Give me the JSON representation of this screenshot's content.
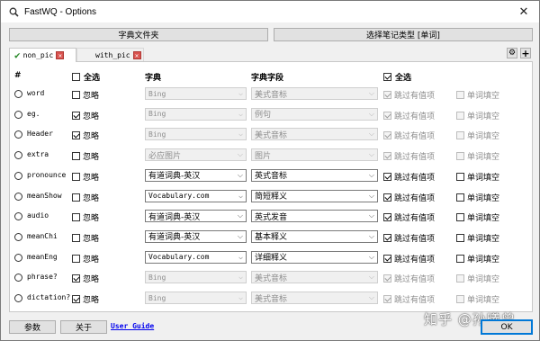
{
  "window": {
    "title": "FastWQ - Options",
    "close_glyph": "✕"
  },
  "toolbar": {
    "dict_folder": "字典文件夹",
    "choose_note_type": "选择笔记类型 [单词]"
  },
  "tabs": [
    {
      "label": "non_pic",
      "active": true
    },
    {
      "label": "with_pic",
      "active": false
    }
  ],
  "tab_actions": {
    "settings_icon": "gear-icon",
    "add_label": "+"
  },
  "headers": {
    "hash": "#",
    "select_all": "全选",
    "dict": "字典",
    "dict_field": "字典字段",
    "select_all_2": "全选"
  },
  "rows": [
    {
      "field": "word",
      "ignore": false,
      "ignore_label": "忽略",
      "dict": "Bing",
      "dict_field": "美式音标",
      "skip": true,
      "skip_label": "跳过有值项",
      "cloze": false,
      "cloze_label": "单词填空",
      "enabled": false
    },
    {
      "field": "eg.",
      "ignore": true,
      "ignore_label": "忽略",
      "dict": "Bing",
      "dict_field": "例句",
      "skip": true,
      "skip_label": "跳过有值项",
      "cloze": false,
      "cloze_label": "单词填空",
      "enabled": false
    },
    {
      "field": "Header",
      "ignore": true,
      "ignore_label": "忽略",
      "dict": "Bing",
      "dict_field": "美式音标",
      "skip": true,
      "skip_label": "跳过有值项",
      "cloze": false,
      "cloze_label": "单词填空",
      "enabled": false
    },
    {
      "field": "extra",
      "ignore": false,
      "ignore_label": "忽略",
      "dict": "必应图片",
      "dict_field": "图片",
      "skip": true,
      "skip_label": "跳过有值项",
      "cloze": false,
      "cloze_label": "单词填空",
      "enabled": false
    },
    {
      "field": "pronounce",
      "ignore": false,
      "ignore_label": "忽略",
      "dict": "有道词典-英汉",
      "dict_field": "英式音标",
      "skip": true,
      "skip_label": "跳过有值项",
      "cloze": false,
      "cloze_label": "单词填空",
      "enabled": true
    },
    {
      "field": "meanShow",
      "ignore": false,
      "ignore_label": "忽略",
      "dict": "Vocabulary.com",
      "dict_field": "简短释义",
      "skip": true,
      "skip_label": "跳过有值项",
      "cloze": false,
      "cloze_label": "单词填空",
      "enabled": true
    },
    {
      "field": "audio",
      "ignore": false,
      "ignore_label": "忽略",
      "dict": "有道词典-英汉",
      "dict_field": "英式发音",
      "skip": true,
      "skip_label": "跳过有值项",
      "cloze": false,
      "cloze_label": "单词填空",
      "enabled": true
    },
    {
      "field": "meanChi",
      "ignore": false,
      "ignore_label": "忽略",
      "dict": "有道词典-英汉",
      "dict_field": "基本释义",
      "skip": true,
      "skip_label": "跳过有值项",
      "cloze": false,
      "cloze_label": "单词填空",
      "enabled": true
    },
    {
      "field": "meanEng",
      "ignore": false,
      "ignore_label": "忽略",
      "dict": "Vocabulary.com",
      "dict_field": "详细释义",
      "skip": true,
      "skip_label": "跳过有值项",
      "cloze": false,
      "cloze_label": "单词填空",
      "enabled": true
    },
    {
      "field": "phrase?",
      "ignore": true,
      "ignore_label": "忽略",
      "dict": "Bing",
      "dict_field": "美式音标",
      "skip": true,
      "skip_label": "跳过有值项",
      "cloze": false,
      "cloze_label": "单词填空",
      "enabled": false
    },
    {
      "field": "dictation?",
      "ignore": true,
      "ignore_label": "忽略",
      "dict": "Bing",
      "dict_field": "美式音标",
      "skip": true,
      "skip_label": "跳过有值项",
      "cloze": false,
      "cloze_label": "单词填空",
      "enabled": false
    }
  ],
  "footer": {
    "params": "参数",
    "about": "关于",
    "user_guide": "User Guide",
    "ok": "OK"
  },
  "watermark": "知乎 @孙曦曾"
}
